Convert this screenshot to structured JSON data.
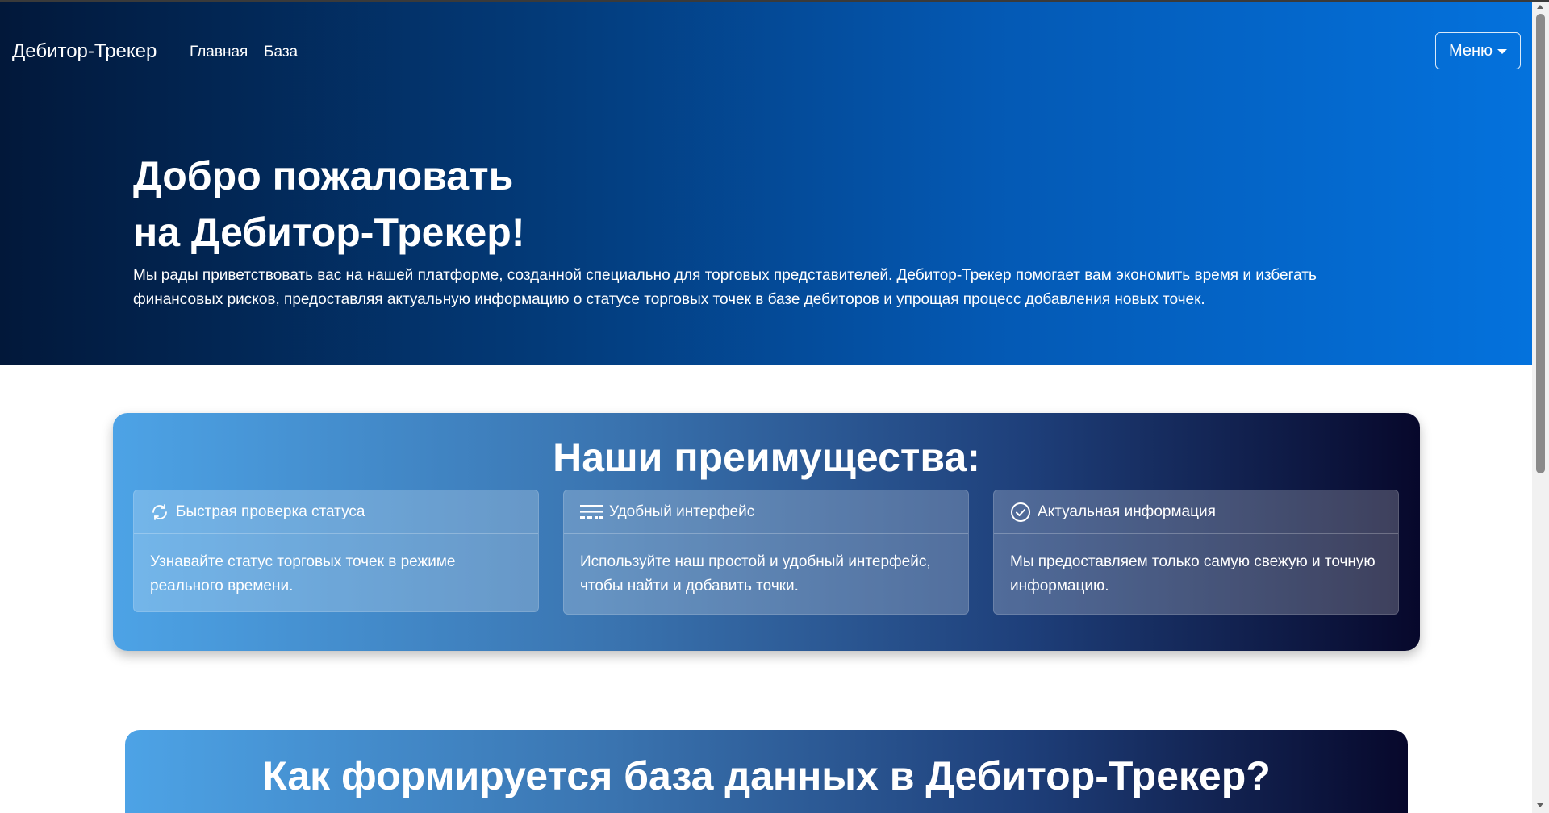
{
  "header": {
    "brand": "Дебитор-Трекер",
    "nav": [
      {
        "label": "Главная"
      },
      {
        "label": "База"
      }
    ],
    "menu_label": "Меню"
  },
  "hero": {
    "title_line1": "Добро пожаловать",
    "title_line2": "на Дебитор-Трекер!",
    "text": "Мы рады приветствовать вас на нашей платформе, созданной специально для торговых представителей. Дебитор-Трекер помогает вам экономить время и избегать финансовых рисков, предоставляя актуальную информацию о статусе торговых точек в базе дебиторов и упрощая процесс добавления новых точек."
  },
  "advantages": {
    "title": "Наши преимущества:",
    "cards": [
      {
        "icon": "refresh-icon",
        "title": "Быстрая проверка статуса",
        "text": "Узнавайте статус торговых точек в режиме реального времени."
      },
      {
        "icon": "interface-icon",
        "title": "Удобный интерфейс",
        "text": "Используйте наш простой и удобный интерфейс, чтобы найти и добавить точки."
      },
      {
        "icon": "check-circle-icon",
        "title": "Актуальная информация",
        "text": "Мы предоставляем только самую свежую и точную информацию."
      }
    ]
  },
  "database": {
    "title": "Как формируется база данных в Дебитор-Трекер?"
  },
  "colors": {
    "hero_start": "#02183a",
    "hero_end": "#0472dd",
    "section_start": "#4da3e6",
    "section_end": "#07082b"
  }
}
